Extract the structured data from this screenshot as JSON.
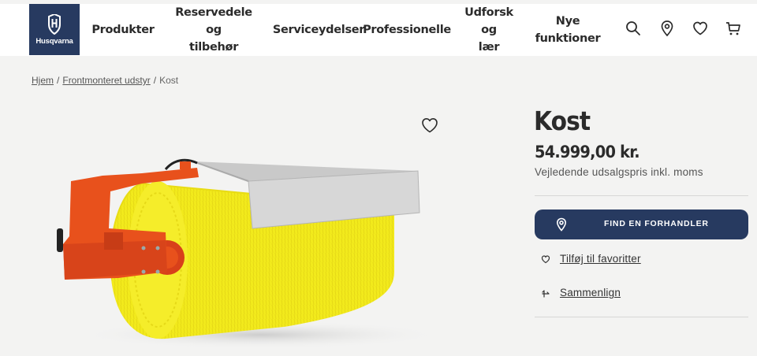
{
  "brand": {
    "name": "Husqvarna",
    "color": "#273a60"
  },
  "nav": [
    {
      "line1": "Produkter",
      "line2": ""
    },
    {
      "line1": "Reservedele og",
      "line2": "tilbehør"
    },
    {
      "line1": "Serviceydelser",
      "line2": ""
    },
    {
      "line1": "Professionelle",
      "line2": ""
    },
    {
      "line1": "Udforsk og",
      "line2": "lær"
    },
    {
      "line1": "Nye",
      "line2": "funktioner"
    }
  ],
  "header_icons": [
    "search-icon",
    "location-pin-icon",
    "heart-icon",
    "cart-icon"
  ],
  "breadcrumb": {
    "items": [
      "Hjem",
      "Frontmonteret udstyr"
    ],
    "separator": "/",
    "current": "Kost"
  },
  "product": {
    "title": "Kost",
    "price": "54.999,00 kr.",
    "price_note": "Vejledende udsalgspris inkl. moms",
    "cta_label": "FIND EN FORHANDLER",
    "favorite_label": "Tilføj til favoritter",
    "compare_label": "Sammenlign"
  },
  "colors": {
    "brush_yellow": "#f2ea1c",
    "frame_orange": "#e8511c",
    "cover_grey": "#c9c9c9"
  }
}
